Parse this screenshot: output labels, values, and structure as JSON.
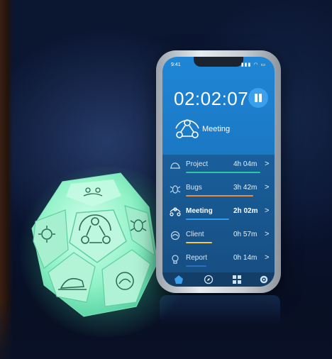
{
  "phone": {
    "status_time": "9:41",
    "status_icons": "▮▮▮ ◠ ▭",
    "timer": "02:02:07",
    "current_activity": "Meeting",
    "tasks": [
      {
        "name": "Project",
        "time": "4h 04m",
        "chevron": ">",
        "bar_color": "#2fc6a6",
        "bar_fraction": 0.95
      },
      {
        "name": "Bugs",
        "time": "3h 42m",
        "chevron": ">",
        "bar_color": "#f08a3c",
        "bar_fraction": 0.86
      },
      {
        "name": "Meeting",
        "time": "2h 02m",
        "chevron": ">",
        "bar_color": "#2f9bf0",
        "bar_fraction": 0.55,
        "active": true
      },
      {
        "name": "Client",
        "time": "0h 57m",
        "chevron": ">",
        "bar_color": "#f2c94c",
        "bar_fraction": 0.34
      },
      {
        "name": "Report",
        "time": "0h 14m",
        "chevron": ">",
        "bar_color": "#2a6fc2",
        "bar_fraction": 0.26
      }
    ],
    "tabs": [
      "home-icon",
      "compass-icon",
      "grid-icon",
      "gear-icon"
    ]
  },
  "colors": {
    "cube_glow": "#6ef3b3",
    "screen_blue": "#1b79c5",
    "background": "#0a1430"
  }
}
